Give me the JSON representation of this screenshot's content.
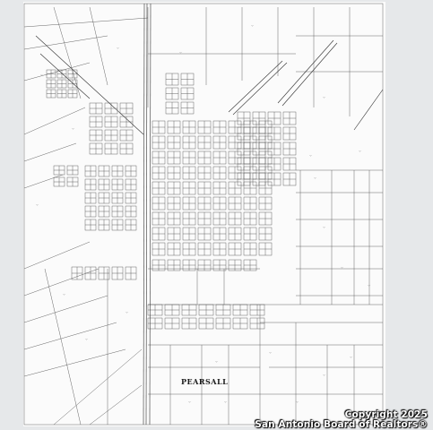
{
  "map": {
    "town_label": "PEARSALL",
    "paper_color": "#fbfbfb",
    "ink_color": "#4a4a4a",
    "frame_color": "#d8dadc"
  },
  "watermark": {
    "line1": "Copyright 2025",
    "line2": "San Antonio Board of Realtors®"
  }
}
